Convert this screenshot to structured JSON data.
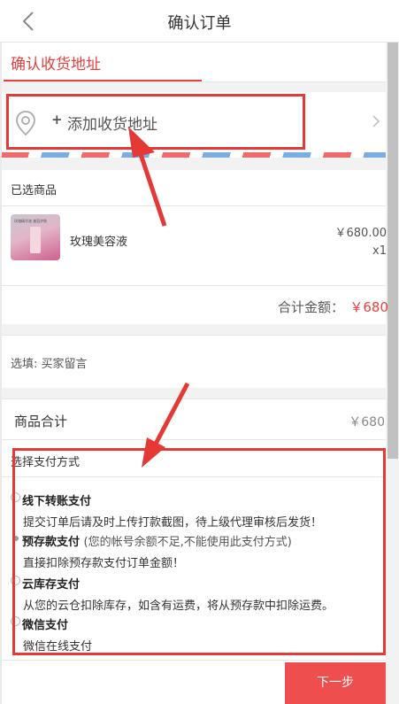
{
  "header": {
    "title": "确认订单",
    "back_icon": "chevron-left-icon"
  },
  "address": {
    "tab_label": "确认收货地址",
    "add_label": "添加收货地址",
    "plus_symbol": "+",
    "icon": "location-pin-icon"
  },
  "products": {
    "section_label": "已选商品",
    "items": [
      {
        "name": "玫瑰美容液",
        "price": "￥680.00",
        "quantity": "x1",
        "thumb_text": "玫瑰精华液 美容护肤"
      }
    ],
    "total_label": "合计金额：",
    "total_value": "￥680"
  },
  "memo": {
    "label": "选填: 买家留言"
  },
  "summary": {
    "label": "商品合计",
    "value": "￥680"
  },
  "payment": {
    "title": "选择支付方式",
    "options": [
      {
        "name": "线下转账支付",
        "note": "",
        "desc": "提交订单后请及时上传打款截图，待上级代理审核后发货！"
      },
      {
        "name": "预存款支付",
        "note": "(您的帐号余额不足,不能使用此支付方式)",
        "desc": "直接扣除预存款支付订单金额！"
      },
      {
        "name": "云库存支付",
        "note": "",
        "desc": "从您的云仓扣除库存，如含有运费，将从预存款中扣除运费。"
      },
      {
        "name": "微信支付",
        "note": "",
        "desc": "微信在线支付"
      }
    ]
  },
  "footer": {
    "next_label": "下一步"
  },
  "colors": {
    "accent": "#e8403f",
    "button": "#ee4e4e",
    "annotation": "#e53935"
  }
}
